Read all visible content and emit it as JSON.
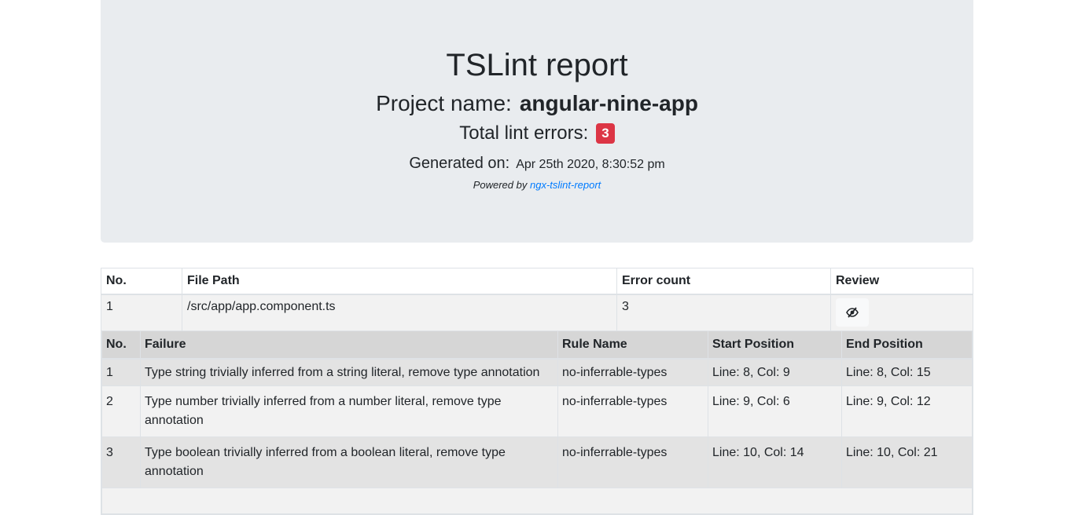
{
  "header": {
    "title": "TSLint report",
    "project_label": "Project name:",
    "project_name": "angular-nine-app",
    "errors_label": "Total lint errors:",
    "errors_count": "3",
    "generated_label": "Generated on:",
    "generated_value": "Apr 25th 2020, 8:30:52 pm",
    "powered_by": "Powered by",
    "powered_link": "ngx-tslint-report"
  },
  "files_table": {
    "headers": [
      "No.",
      "File Path",
      "Error count",
      "Review"
    ],
    "rows": [
      {
        "no": "1",
        "path": "/src/app/app.component.ts",
        "count": "3",
        "review_icon": "eye-slash-icon"
      }
    ]
  },
  "failures_table": {
    "headers": [
      "No.",
      "Failure",
      "Rule Name",
      "Start Position",
      "End Position"
    ],
    "rows": [
      {
        "no": "1",
        "failure": "Type string trivially inferred from a string literal, remove type annotation",
        "rule": "no-inferrable-types",
        "start": "Line: 8, Col: 9",
        "end": "Line: 8, Col: 15"
      },
      {
        "no": "2",
        "failure": "Type number trivially inferred from a number literal, remove type annotation",
        "rule": "no-inferrable-types",
        "start": "Line: 9, Col: 6",
        "end": "Line: 9, Col: 12"
      },
      {
        "no": "3",
        "failure": "Type boolean trivially inferred from a boolean literal, remove type annotation",
        "rule": "no-inferrable-types",
        "start": "Line: 10, Col: 14",
        "end": "Line: 10, Col: 21"
      }
    ]
  },
  "colors": {
    "badge": "#dc3545",
    "link": "#007bff",
    "jumbotron": "#e9ecef"
  }
}
